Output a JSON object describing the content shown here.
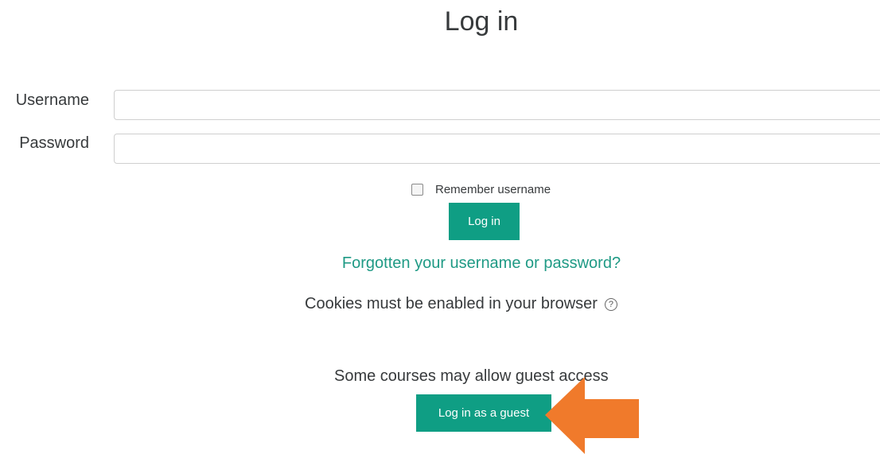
{
  "page": {
    "title": "Log in"
  },
  "form": {
    "username_label": "Username",
    "username_value": "",
    "password_label": "Password",
    "password_value": "",
    "remember_label": "Remember username",
    "login_button": "Log in",
    "forgot_link": "Forgotten your username or password?",
    "cookies_text": "Cookies must be enabled in your browser",
    "guest_text": "Some courses may allow guest access",
    "guest_button": "Log in as a guest",
    "help_icon": "?"
  },
  "colors": {
    "accent": "#0f9e84",
    "link": "#1f9a85",
    "arrow": "#f07a2b"
  },
  "icons": {
    "help": "help-icon",
    "annotation_arrow": "arrow-icon"
  }
}
